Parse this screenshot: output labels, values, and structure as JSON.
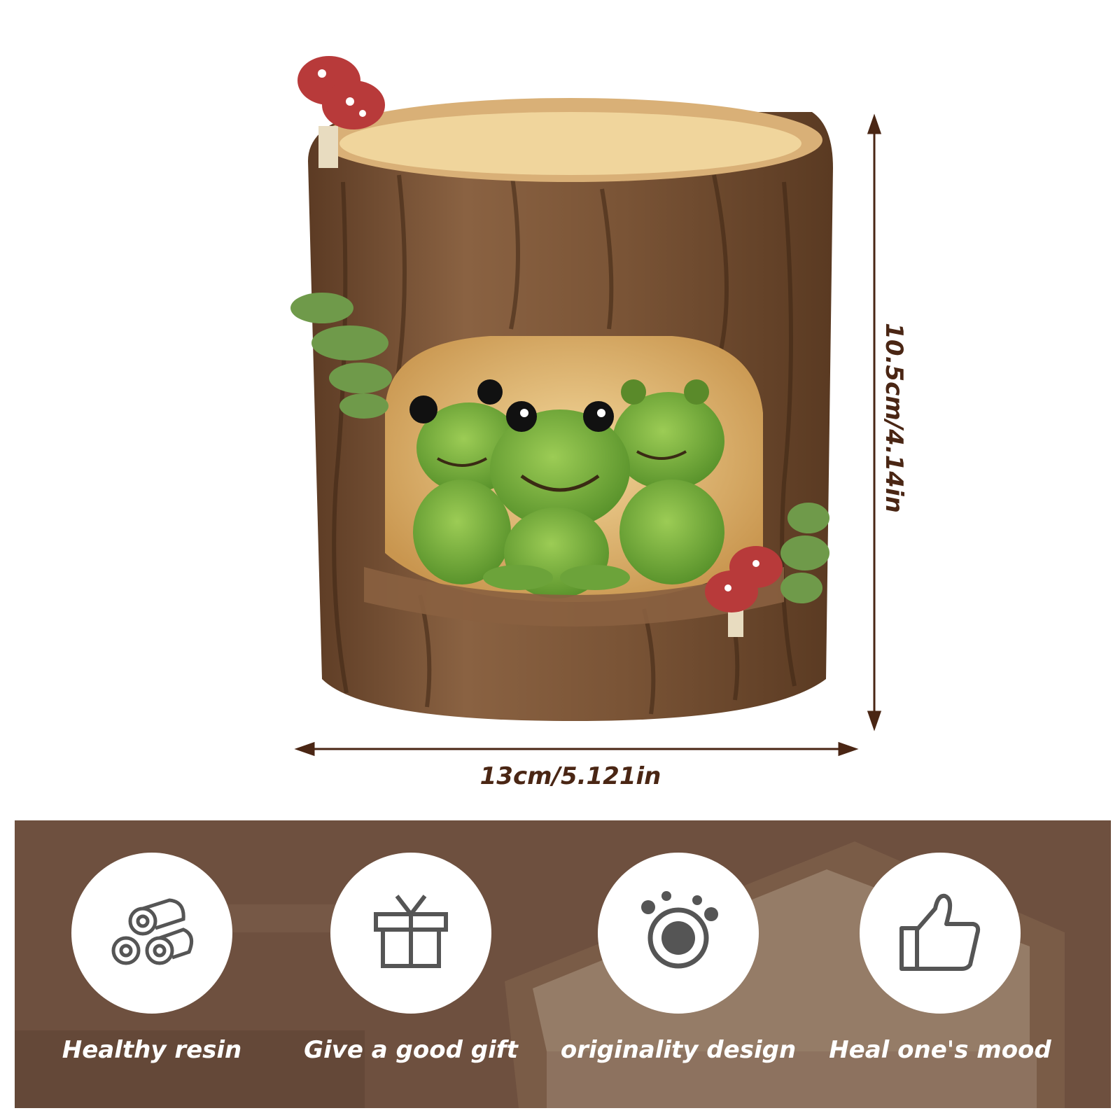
{
  "product": {
    "photo_name": "tree stump planter with three frogs",
    "width_label": "13cm/5.121in",
    "height_label": "10.5cm/4.14in"
  },
  "features": [
    {
      "label": "Healthy resin",
      "icon": "logs-icon"
    },
    {
      "label": "Give a good gift",
      "icon": "gift-box-icon"
    },
    {
      "label": "originality design",
      "icon": "creative-circle-icon"
    },
    {
      "label": "Heal one's mood",
      "icon": "thumbs-up-icon"
    }
  ],
  "colors": {
    "dimension_text": "#4a2614",
    "banner": "#6b4d3c",
    "icon_stroke": "#555555",
    "feature_text": "#ffffff"
  }
}
